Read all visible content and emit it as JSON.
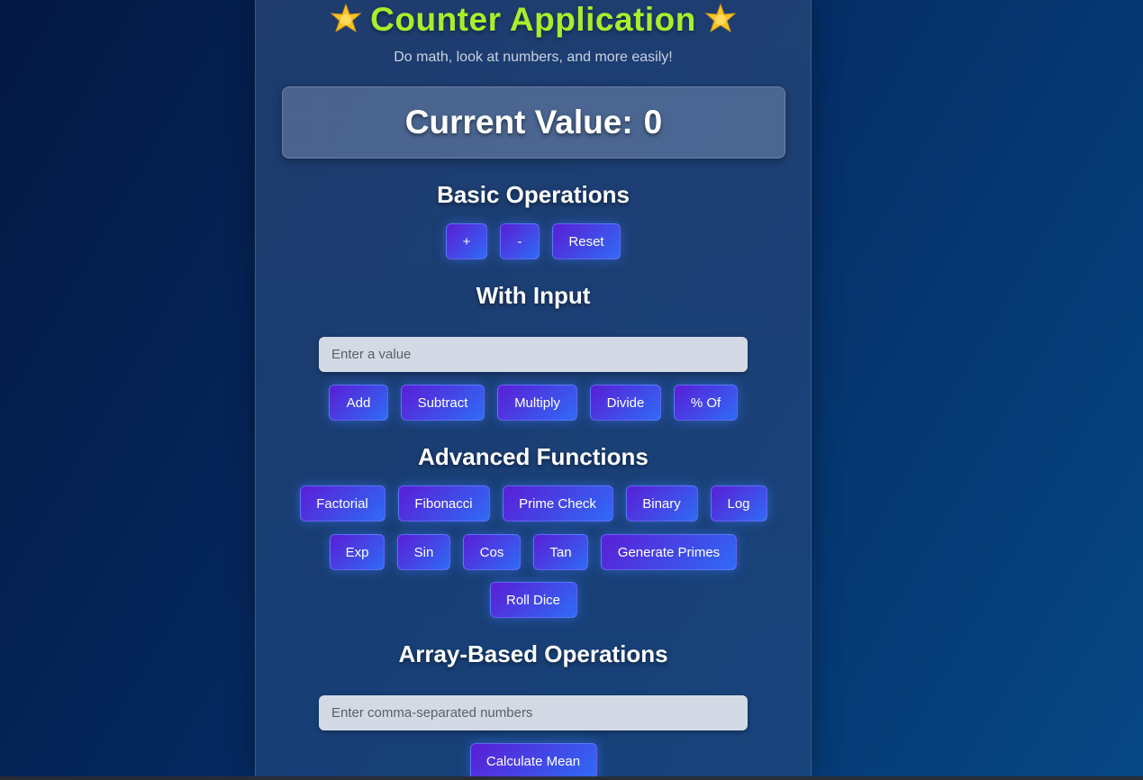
{
  "header": {
    "title": "Counter Application",
    "subtitle": "Do math, look at numbers, and more easily!"
  },
  "display": {
    "label": "Current Value:",
    "value": "0"
  },
  "basic": {
    "title": "Basic Operations",
    "buttons": [
      "+",
      "-",
      "Reset"
    ]
  },
  "with_input": {
    "title": "With Input",
    "placeholder": "Enter a value",
    "buttons": [
      "Add",
      "Subtract",
      "Multiply",
      "Divide",
      "% Of"
    ]
  },
  "advanced": {
    "title": "Advanced Functions",
    "row1": [
      "Factorial",
      "Fibonacci",
      "Prime Check",
      "Binary",
      "Log"
    ],
    "row2": [
      "Exp",
      "Sin",
      "Cos",
      "Tan",
      "Generate Primes"
    ],
    "row3": [
      "Roll Dice"
    ]
  },
  "array": {
    "title": "Array-Based Operations",
    "placeholder": "Enter comma-separated numbers",
    "buttons": [
      "Calculate Mean"
    ]
  },
  "colors": {
    "title": "#a8ee2c",
    "button_start": "#5a1ed6",
    "button_end": "#2f6bf5"
  },
  "icons": {
    "title_left": "star-icon",
    "title_right": "star-icon"
  }
}
